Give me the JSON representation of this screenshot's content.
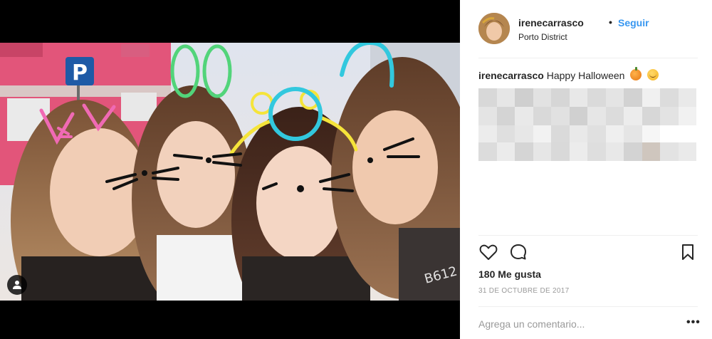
{
  "post": {
    "username": "irenecarrasco",
    "separator": "•",
    "follow_label": "Seguir",
    "location": "Porto District",
    "caption_user": "irenecarrasco",
    "caption_text": "Happy Halloween",
    "caption_emojis": [
      "pumpkin-icon",
      "relieved-face-icon"
    ],
    "likes_text": "180 Me gusta",
    "date_text": "31 DE OCTUBRE DE 2017",
    "comment_placeholder": "Agrega un comentario...",
    "more_label": "•••",
    "photo_overlay_text": "B612",
    "parking_sign_text": "P"
  },
  "icons": {
    "like": "heart-icon",
    "comment": "comment-icon",
    "save": "bookmark-icon",
    "user_tag": "person-icon"
  },
  "colors": {
    "follow_blue": "#3897f0",
    "text": "#262626",
    "muted": "#999999",
    "divider": "#efefef",
    "media_bg": "#000000"
  }
}
